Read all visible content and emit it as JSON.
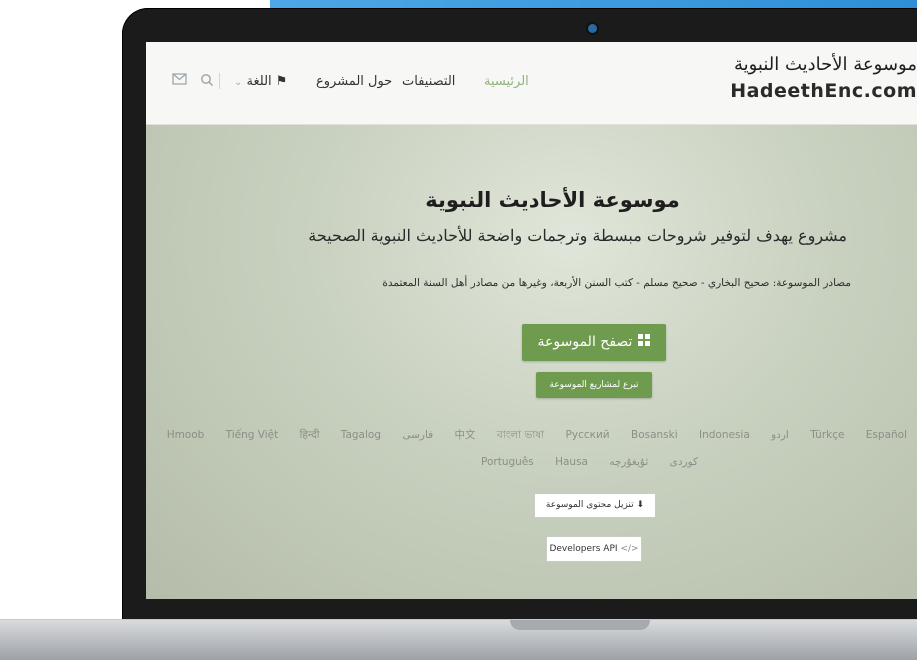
{
  "logo": {
    "arabic": "موسوعة الأحاديث النبوية",
    "latin": "HadeethEnc.com"
  },
  "nav": {
    "home": "الرئيسية",
    "categories": "التصنيفات",
    "about": "حول المشروع",
    "language": "اللغة"
  },
  "icons": {
    "search": "search-icon",
    "mail": "mail-icon",
    "flag": "flag-icon",
    "grid": "grid-icon",
    "download": "download-icon",
    "code": "code-icon"
  },
  "hero": {
    "title": "موسوعة الأحاديث النبوية",
    "subtitle": "مشروع يهدف لتوفير شروحات مبسطة وترجمات واضحة للأحاديث النبوية الصحيحة",
    "sources": "مصادر الموسوعة: صحيح البخاري - صحيح مسلم - كتب السنن الأربعة، وغيرها من مصادر أهل السنة المعتمدة"
  },
  "buttons": {
    "browse": "تصفح الموسوعة",
    "donate": "تبرع لمشاريع الموسوعة",
    "download": "تنزيل محتوى الموسوعة",
    "api": "Developers API"
  },
  "languages_row1": [
    "Español",
    "Türkçe",
    "اردو",
    "Indonesia",
    "Bosanski",
    "Русский",
    "বাংলা ভাষা",
    "中文",
    "فارسی",
    "Tagalog",
    "हिन्दी",
    "Tiếng Việt",
    "Hmoob"
  ],
  "languages_row2": [
    "Português",
    "Hausa",
    "کوردی",
    "ئۇيغۇرچە"
  ],
  "colors": {
    "accent_green": "#6e9b4e",
    "nav_active": "#8fb57a",
    "accent_blue": "#2e8fd6"
  }
}
